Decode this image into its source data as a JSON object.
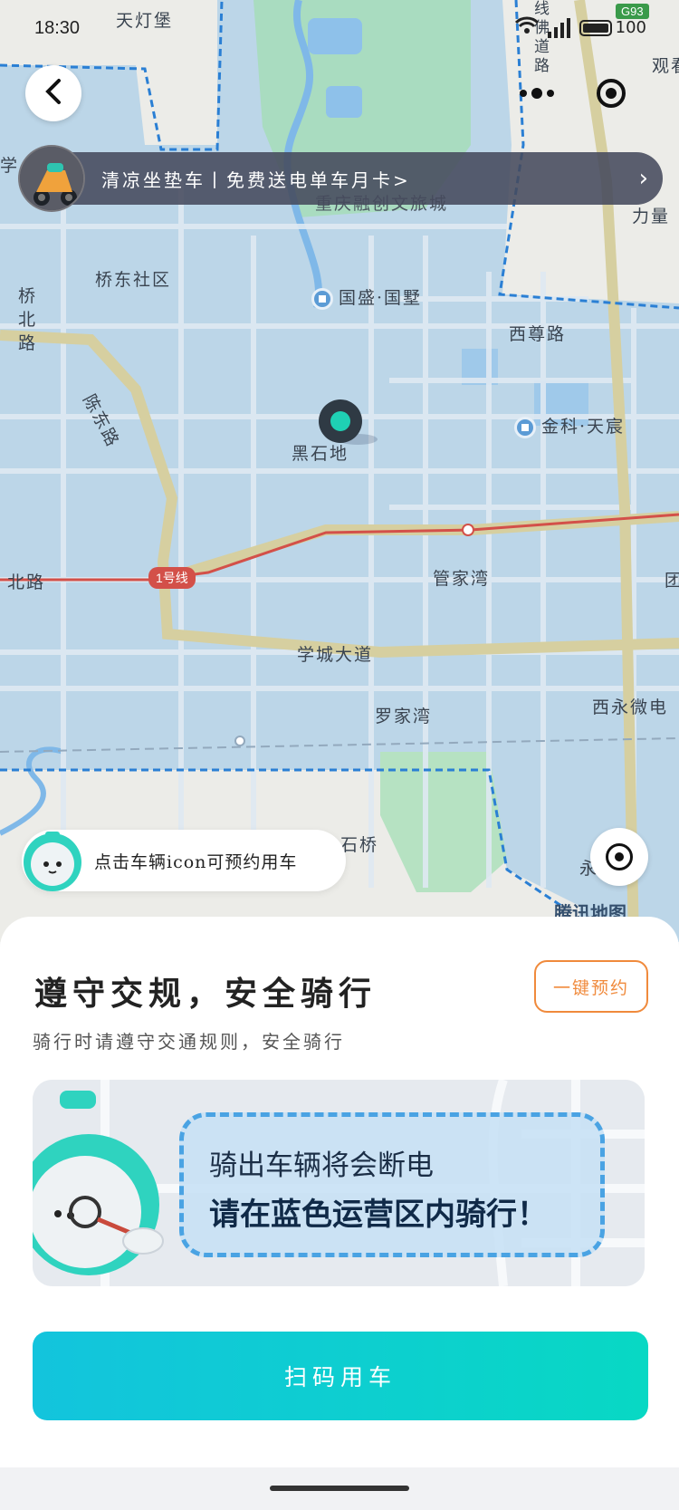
{
  "status_bar": {
    "time": "18:30",
    "battery": "100",
    "road_badge": "G93"
  },
  "map": {
    "labels": {
      "tiandengbao": "天灯堡",
      "qiaodong": "桥东社区",
      "qiaobei": "桥北路",
      "chendong": "陈东路",
      "chongqing_rongchuang": "重庆融创文旅城",
      "guosheng": "国盛·国墅",
      "xiyong": "西尊路",
      "jinke": "金科·天宸",
      "heishidi": "黑石地",
      "guanjiawan": "管家湾",
      "xuecheng": "学城大道",
      "luojiawan": "罗家湾",
      "xiyongwei": "西永微电",
      "shiqiao": "石桥",
      "beilu": "北路",
      "liliang": "力量",
      "guan": "观看",
      "xue": "学",
      "yi": "永",
      "tuan": "团",
      "line1": "1号线",
      "xianlu": "线佛道路"
    },
    "watermark": "腾讯地图"
  },
  "promo": {
    "text": "清凉坐垫车丨免费送电单车月卡>",
    "arrow": "›"
  },
  "hint": {
    "text": "点击车辆icon可预约用车"
  },
  "sheet": {
    "title": "遵守交规，安全骑行",
    "subtitle": "骑行时请遵守交通规则，安全骑行",
    "reserve_label": "一键预约",
    "notice_line1": "骑出车辆将会断电",
    "notice_line2": "请在蓝色运营区内骑行！"
  },
  "cta": {
    "scan_label": "扫码用车"
  },
  "colors": {
    "accent_teal": "#13c4dd",
    "accent_orange": "#f08a3c",
    "map_blue": "#bcd6e8",
    "operation_border": "#2a7fd4"
  }
}
